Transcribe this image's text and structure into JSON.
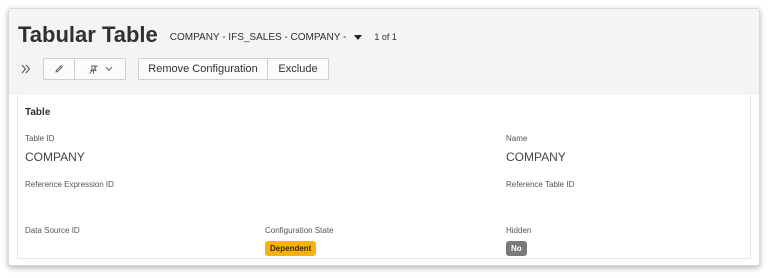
{
  "header": {
    "title": "Tabular Table",
    "record_key": "COMPANY - IFS_SALES - COMPANY -",
    "record_count": "1 of 1"
  },
  "toolbar": {
    "remove_label": "Remove Configuration",
    "exclude_label": "Exclude"
  },
  "group": {
    "title": "Table",
    "fields": {
      "table_id": {
        "label": "Table ID",
        "value": "COMPANY"
      },
      "name": {
        "label": "Name",
        "value": "COMPANY"
      },
      "reference_expression_id": {
        "label": "Reference Expression ID",
        "value": ""
      },
      "reference_table_id": {
        "label": "Reference Table ID",
        "value": ""
      },
      "data_source_id": {
        "label": "Data Source ID",
        "value": ""
      },
      "configuration_state": {
        "label": "Configuration State",
        "value": "Dependent"
      },
      "hidden": {
        "label": "Hidden",
        "value": "No"
      }
    }
  },
  "colors": {
    "badge_dependent": "#f5b30b",
    "badge_no": "#7a7a7a",
    "header_bg": "#f4f4f4"
  }
}
